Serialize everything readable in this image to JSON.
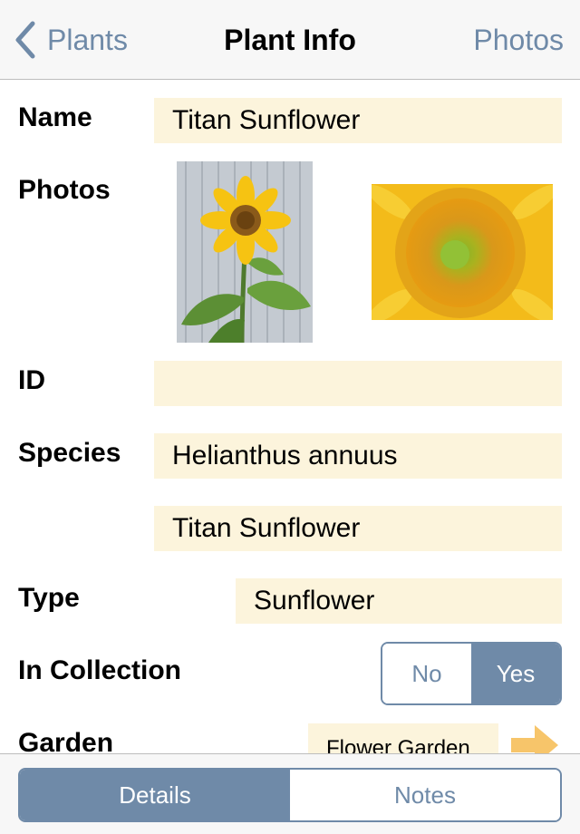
{
  "nav": {
    "back_label": "Plants",
    "title": "Plant Info",
    "right_label": "Photos"
  },
  "form": {
    "name_label": "Name",
    "name_value": "Titan Sunflower",
    "photos_label": "Photos",
    "id_label": "ID",
    "id_value": "",
    "species_label": "Species",
    "species_value": "Helianthus annuus",
    "common_name_value": "Titan Sunflower",
    "type_label": "Type",
    "type_value": "Sunflower",
    "collection_label": "In Collection",
    "collection_options": [
      "No",
      "Yes"
    ],
    "collection_selected": "Yes",
    "garden_label": "Garden",
    "garden_value": "Flower Garden"
  },
  "tabs": {
    "items": [
      "Details",
      "Notes"
    ],
    "selected": "Details"
  },
  "colors": {
    "accent": "#6f8aa8",
    "field_bg": "#fcf4dc",
    "arrow": "#f7c56a"
  }
}
